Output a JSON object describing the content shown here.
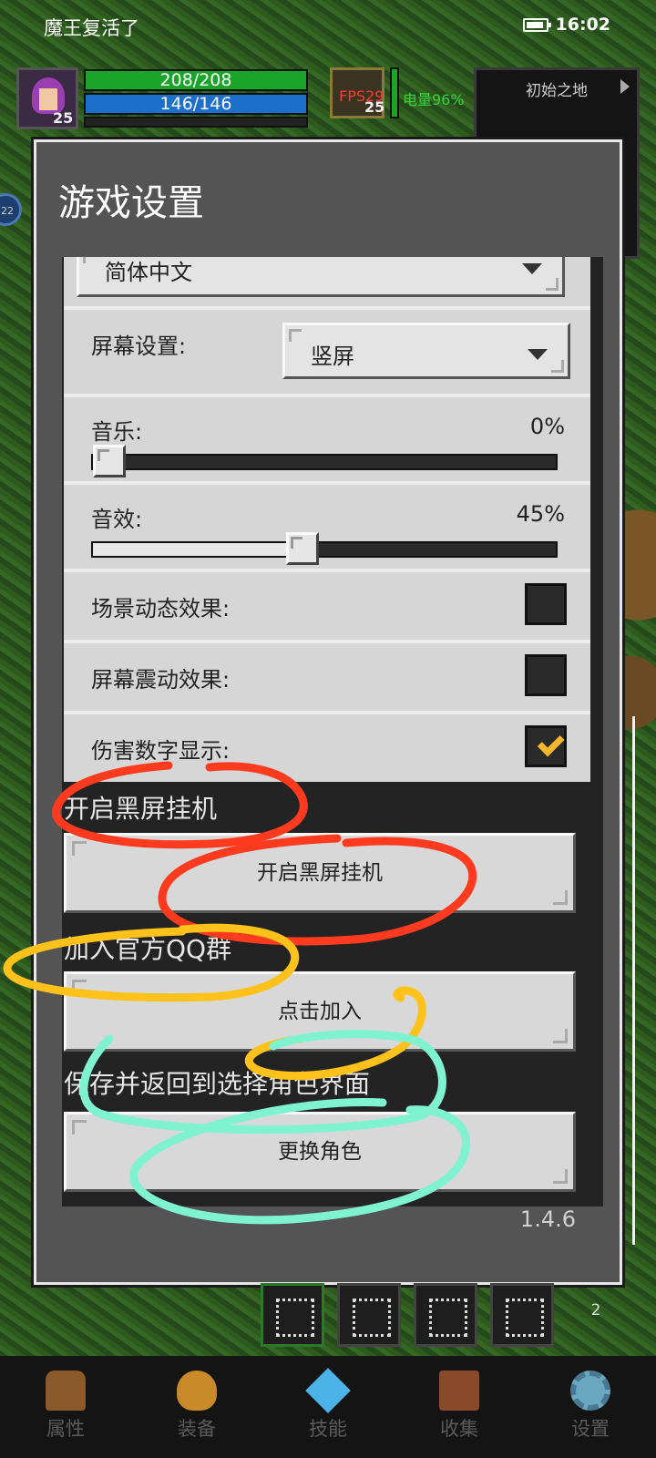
{
  "status_bar": {
    "app_title": "魔王复活了",
    "time": "16:02"
  },
  "hud": {
    "hp": "208/208",
    "mp": "146/146",
    "player_level": "25",
    "companion_level": "25",
    "fps": "FPS29",
    "energy": "电量96%",
    "map_name": "初始之地",
    "side_badge": "22"
  },
  "dialog": {
    "title": "游戏设置",
    "language_value": "简体中文",
    "screen": {
      "label": "屏幕设置:",
      "value": "竖屏"
    },
    "music": {
      "label": "音乐:",
      "value": "0%",
      "level": 0
    },
    "sfx": {
      "label": "音效:",
      "value": "45%",
      "level": 0.45
    },
    "scene_fx": {
      "label": "场景动态效果:",
      "checked": false
    },
    "shake_fx": {
      "label": "屏幕震动效果:",
      "checked": false
    },
    "damage_numbers": {
      "label": "伤害数字显示:",
      "checked": true
    },
    "black_screen": {
      "section": "开启黑屏挂机",
      "button": "开启黑屏挂机"
    },
    "qq_group": {
      "section": "加入官方QQ群",
      "button": "点击加入"
    },
    "switch_role": {
      "section": "保存并返回到选择角色界面",
      "button": "更换角色"
    },
    "version": "1.4.6"
  },
  "skill_bar": {
    "page": "2"
  },
  "bottom_nav": [
    {
      "label": "属性",
      "icon": "helmet-icon"
    },
    {
      "label": "装备",
      "icon": "bag-icon"
    },
    {
      "label": "技能",
      "icon": "gem-icon"
    },
    {
      "label": "收集",
      "icon": "book-icon"
    },
    {
      "label": "设置",
      "icon": "gear-icon"
    }
  ],
  "annotation_colors": {
    "red": "#ff3b1f",
    "yellow": "#ffc21a",
    "cyan": "#7ff2d0"
  }
}
